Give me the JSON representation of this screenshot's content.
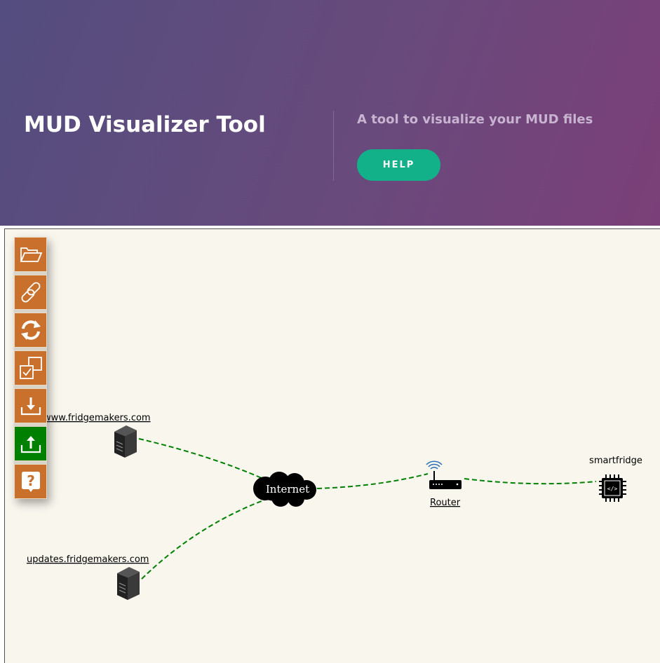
{
  "header": {
    "title": "MUD Visualizer Tool",
    "subtitle": "A tool to visualize your MUD files",
    "help_label": "HELP"
  },
  "toolbar": {
    "items": [
      {
        "icon": "folder-open-icon",
        "active": false
      },
      {
        "icon": "link-icon",
        "active": false
      },
      {
        "icon": "refresh-icon",
        "active": false
      },
      {
        "icon": "select-copy-icon",
        "active": false
      },
      {
        "icon": "download-icon",
        "active": false
      },
      {
        "icon": "upload-icon",
        "active": true
      },
      {
        "icon": "help-icon",
        "active": false
      }
    ]
  },
  "graph": {
    "nodes": {
      "fridgemakers_www": {
        "label": "www.fridgemakers.com",
        "icon": "server-icon"
      },
      "fridgemakers_updates": {
        "label": "updates.fridgemakers.com",
        "icon": "server-icon"
      },
      "internet": {
        "label": "Internet",
        "icon": "cloud-icon"
      },
      "router": {
        "label": "Router",
        "icon": "router-icon"
      },
      "smartfridge": {
        "label": "smartfridge",
        "icon": "chip-icon"
      }
    },
    "links": [
      {
        "from": "www.fridgemakers.com",
        "to": "Internet"
      },
      {
        "from": "updates.fridgemakers.com",
        "to": "Internet"
      },
      {
        "from": "Internet",
        "to": "Router"
      },
      {
        "from": "Router",
        "to": "smartfridge"
      }
    ],
    "link_color": "#008000"
  },
  "colors": {
    "header_gradient_start": "#544d7f",
    "header_gradient_end": "#7b3f78",
    "help_button": "#13b18a",
    "tool_button": "#c8702c",
    "tool_active": "#008000",
    "canvas_background": "#f8f6ed"
  }
}
